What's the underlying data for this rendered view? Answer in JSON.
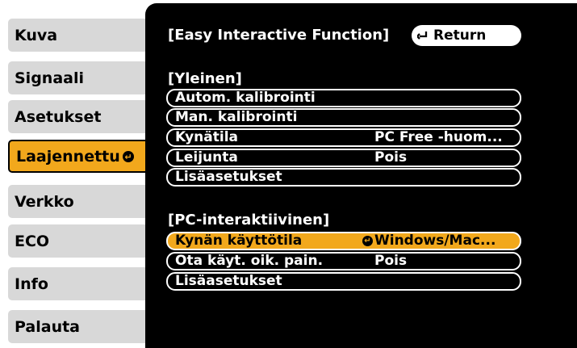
{
  "sidebar": {
    "items": [
      {
        "label": "Kuva"
      },
      {
        "label": "Signaali"
      },
      {
        "label": "Asetukset"
      },
      {
        "label": "Laajennettu"
      },
      {
        "label": "Verkko"
      },
      {
        "label": "ECO"
      },
      {
        "label": "Info"
      },
      {
        "label": "Palauta"
      }
    ],
    "active_item": "Laajennettu"
  },
  "header": {
    "title": "[Easy Interactive Function]",
    "return_label": "Return"
  },
  "sections": [
    {
      "heading": "[Yleinen]",
      "rows": [
        {
          "label": "Autom. kalibrointi",
          "value": ""
        },
        {
          "label": "Man. kalibrointi",
          "value": ""
        },
        {
          "label": "Kynätila",
          "value": "PC Free -huom..."
        },
        {
          "label": "Leijunta",
          "value": "Pois"
        },
        {
          "label": "Lisäasetukset",
          "value": ""
        }
      ]
    },
    {
      "heading": "[PC-interaktiivinen]",
      "rows": [
        {
          "label": "Kynän käyttötila",
          "value": "Windows/Mac..."
        },
        {
          "label": "Ota käyt. oik. pain.",
          "value": "Pois"
        },
        {
          "label": "Lisäasetukset",
          "value": ""
        }
      ]
    }
  ],
  "colors": {
    "accent": "#f2a81c",
    "panel": "#000000",
    "sidebar_button": "#d8d8d8"
  },
  "icons": {
    "enter": "enter-return-icon",
    "return_arrow": "return-arrow-icon"
  }
}
